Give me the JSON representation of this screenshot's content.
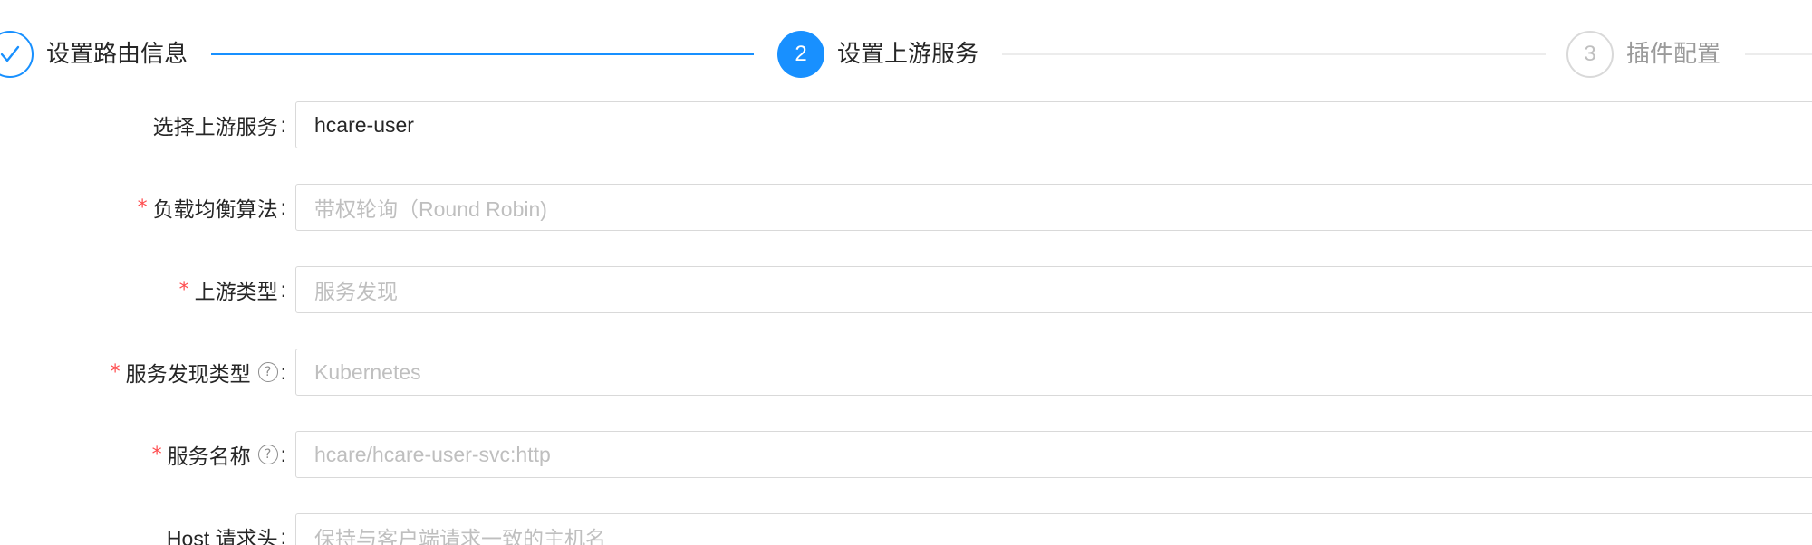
{
  "steps": [
    {
      "title": "设置路由信息",
      "status": "finished",
      "icon": "check-icon"
    },
    {
      "title": "设置上游服务",
      "status": "active",
      "number": "2"
    },
    {
      "title": "插件配置",
      "status": "waiting",
      "number": "3"
    }
  ],
  "form": {
    "upstream_service": {
      "label": "选择上游服务",
      "value": "hcare-user"
    },
    "lb_algorithm": {
      "label": "负载均衡算法",
      "required": true,
      "placeholder": "带权轮询（Round Robin)"
    },
    "upstream_type": {
      "label": "上游类型",
      "required": true,
      "placeholder": "服务发现"
    },
    "discovery_type": {
      "label": "服务发现类型",
      "required": true,
      "help_icon": "question-circle-icon",
      "placeholder": "Kubernetes"
    },
    "service_name": {
      "label": "服务名称",
      "required": true,
      "help_icon": "question-circle-icon",
      "placeholder": "hcare/hcare-user-svc:http"
    },
    "host_header": {
      "label": "Host 请求头",
      "placeholder": "保持与客户端请求一致的主机名"
    }
  },
  "colors": {
    "primary": "#1890ff",
    "required": "#ff4d4f",
    "placeholder": "#bfbfbf",
    "border": "#d9d9d9"
  }
}
